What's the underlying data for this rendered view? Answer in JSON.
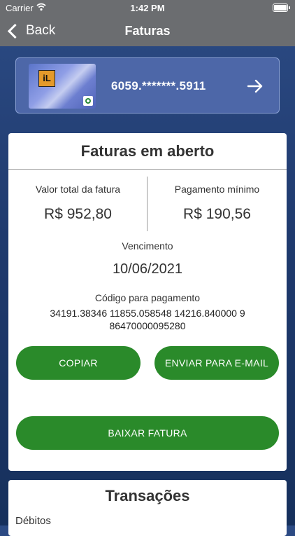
{
  "status_bar": {
    "carrier": "Carrier",
    "time": "1:42 PM"
  },
  "nav": {
    "back_label": "Back",
    "title": "Faturas"
  },
  "card": {
    "number": "6059.*******.5911",
    "logo_text": "iL"
  },
  "invoice": {
    "title": "Faturas em aberto",
    "total_label": "Valor total da fatura",
    "total_value": "R$ 952,80",
    "minimum_label": "Pagamento mínimo",
    "minimum_value": "R$ 190,56",
    "due_label": "Vencimento",
    "due_value": "10/06/2021",
    "payment_code_label": "Código para pagamento",
    "payment_code_line1": "34191.38346 11855.058548 14216.840000 9",
    "payment_code_line2": "86470000095280",
    "copy_button": "COPIAR",
    "email_button": "ENVIAR PARA E-MAIL",
    "download_button": "BAIXAR FATURA"
  },
  "transactions": {
    "title": "Transações",
    "subtitle": "Débitos"
  },
  "colors": {
    "accent_green": "#2a8a2a",
    "nav_gray": "#6b6d70",
    "background_blue": "#1f3a6e"
  }
}
